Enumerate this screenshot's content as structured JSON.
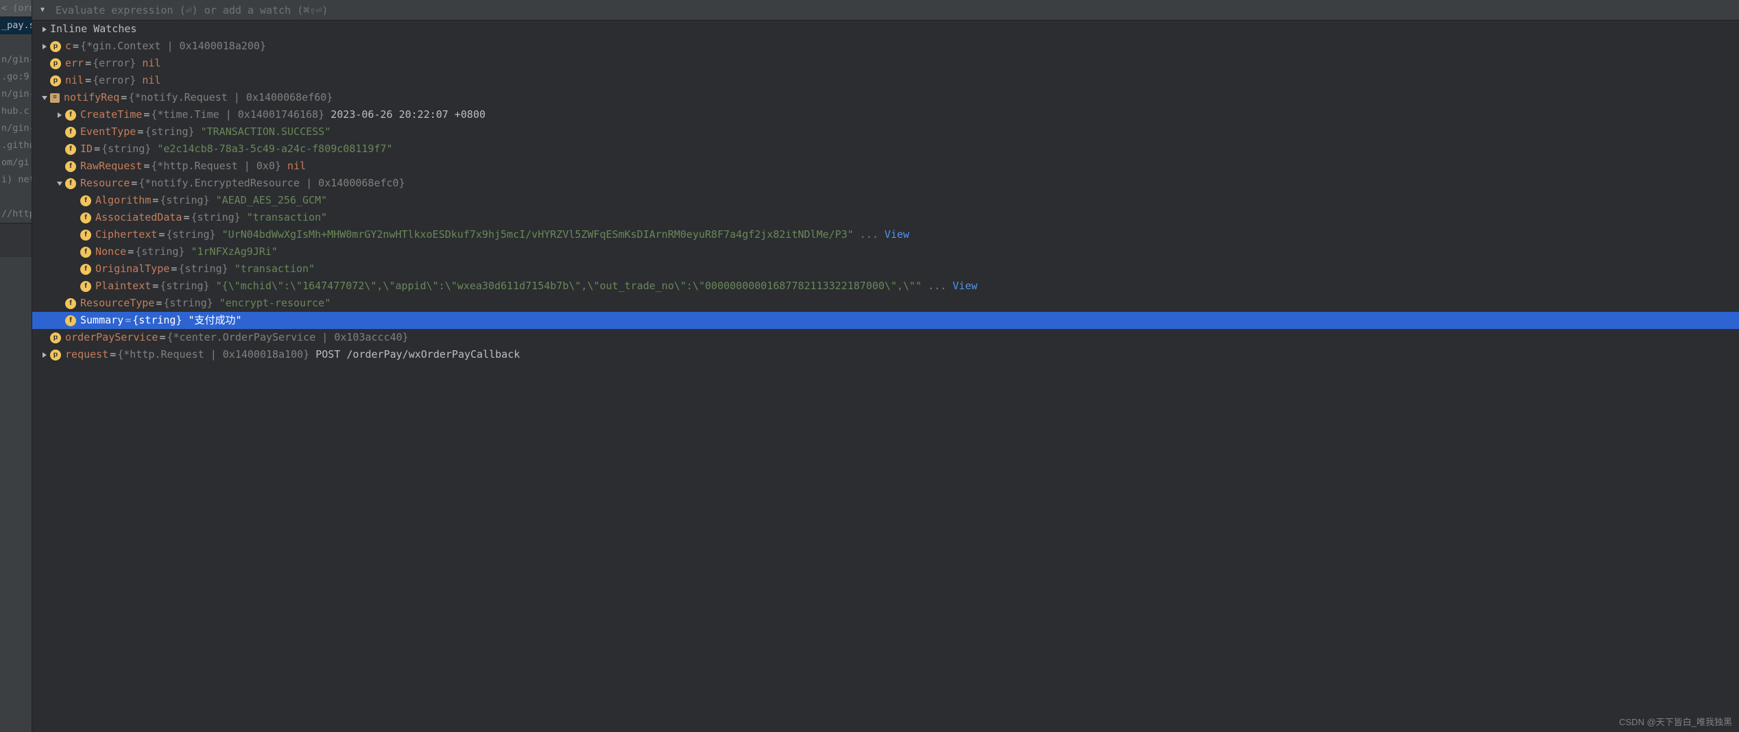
{
  "toolbar": {
    "eval_placeholder": "Evaluate expression (⏎) or add a watch (⌘⇧⏎)"
  },
  "sidebar": {
    "tab": "< (ord",
    "rows": [
      "_pay.s",
      "",
      "n/gin-",
      ".go:9",
      "n/gin-",
      "hub.c",
      "n/gin-",
      ".githu",
      "om/gi",
      "i) net/",
      "",
      "//http",
      "",
      "",
      "",
      "",
      ""
    ]
  },
  "tree": {
    "header": "Inline Watches",
    "c_name": "c",
    "c_type": "{*gin.Context | 0x1400018a200}",
    "err_name": "err",
    "err_type": "{error}",
    "err_val": "nil",
    "nil_name": "nil",
    "nil_type": "{error}",
    "nil_val": "nil",
    "notifyReq_name": "notifyReq",
    "notifyReq_type": "{*notify.Request | 0x1400068ef60}",
    "createTime_name": "CreateTime",
    "createTime_type": "{*time.Time | 0x14001746168}",
    "createTime_val": "2023-06-26 20:22:07 +0800",
    "eventType_name": "EventType",
    "eventType_type": "{string}",
    "eventType_val": "\"TRANSACTION.SUCCESS\"",
    "id_name": "ID",
    "id_type": "{string}",
    "id_val": "\"e2c14cb8-78a3-5c49-a24c-f809c08119f7\"",
    "rawRequest_name": "RawRequest",
    "rawRequest_type": "{*http.Request | 0x0}",
    "rawRequest_val": "nil",
    "resource_name": "Resource",
    "resource_type": "{*notify.EncryptedResource | 0x1400068efc0}",
    "algorithm_name": "Algorithm",
    "algorithm_type": "{string}",
    "algorithm_val": "\"AEAD_AES_256_GCM\"",
    "associatedData_name": "AssociatedData",
    "associatedData_type": "{string}",
    "associatedData_val": "\"transaction\"",
    "ciphertext_name": "Ciphertext",
    "ciphertext_type": "{string}",
    "ciphertext_val": "\"UrN04bdWwXgIsMh+MHW0mrGY2nwHTlkxoESDkuf7x9hj5mcI/vHYRZVl5ZWFqESmKsDIArnRM0eyuR8F7a4gf2jx82itNDlMe/P3\"",
    "ciphertext_more": "...",
    "nonce_name": "Nonce",
    "nonce_type": "{string}",
    "nonce_val": "\"1rNFXzAg9JRi\"",
    "originalType_name": "OriginalType",
    "originalType_type": "{string}",
    "originalType_val": "\"transaction\"",
    "plaintext_name": "Plaintext",
    "plaintext_type": "{string}",
    "plaintext_val": "\"{\\\"mchid\\\":\\\"1647477072\\\",\\\"appid\\\":\\\"wxea30d611d7154b7b\\\",\\\"out_trade_no\\\":\\\"00000000001687782113322187000\\\",\\\"\"",
    "plaintext_more": "...",
    "resourceType_name": "ResourceType",
    "resourceType_type": "{string}",
    "resourceType_val": "\"encrypt-resource\"",
    "summary_name": "Summary",
    "summary_type": "{string}",
    "summary_val": "\"支付成功\"",
    "orderPayService_name": "orderPayService",
    "orderPayService_type": "{*center.OrderPayService | 0x103accc40}",
    "request_name": "request",
    "request_type": "{*http.Request | 0x1400018a100}",
    "request_val": "POST /orderPay/wxOrderPayCallback",
    "view_label": "View"
  },
  "watermark": "CSDN @天下皆白_唯我独黑"
}
